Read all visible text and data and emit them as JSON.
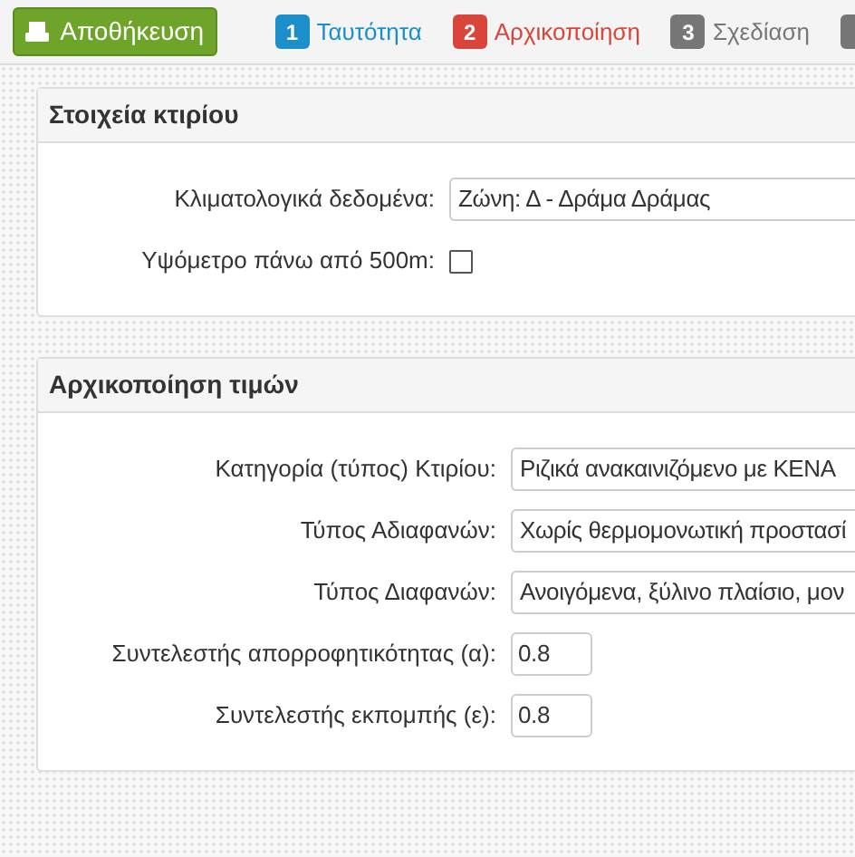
{
  "toolbar": {
    "save_button": {
      "label": "Αποθήκευση"
    },
    "steps": [
      {
        "number": "1",
        "label": "Ταυτότητα",
        "color": "#1a8fc9"
      },
      {
        "number": "2",
        "label": "Αρχικοποίηση",
        "color": "#d9453a"
      },
      {
        "number": "3",
        "label": "Σχεδίαση",
        "color": "#777777"
      }
    ]
  },
  "panels": [
    {
      "title": "Στοιχεία κτιρίου",
      "fields": [
        {
          "kind": "select",
          "label": "Κλιματολογικά δεδομένα:",
          "value": "Ζώνη: Δ - Δράμα Δράμας"
        },
        {
          "kind": "checkbox",
          "label": "Υψόμετρο πάνω από 500m:",
          "checked": false
        }
      ]
    },
    {
      "title": "Αρχικοποίηση τιμών",
      "fields": [
        {
          "kind": "select",
          "label": "Κατηγορία (τύπος) Κτιρίου:",
          "value": "Ριζικά ανακαινιζόμενο με ΚΕΝΑ"
        },
        {
          "kind": "select",
          "label": "Τύπος Αδιαφανών:",
          "value": "Χωρίς θερμομονωτική προστασί"
        },
        {
          "kind": "select",
          "label": "Τύπος Διαφανών:",
          "value": "Ανοιγόμενα, ξύλινο πλαίσιο, μον"
        },
        {
          "kind": "number",
          "label": "Συντελεστής απορροφητικότητας (α):",
          "value": "0.8"
        },
        {
          "kind": "number",
          "label": "Συντελεστής εκπομπής (ε):",
          "value": "0.8"
        }
      ]
    }
  ]
}
